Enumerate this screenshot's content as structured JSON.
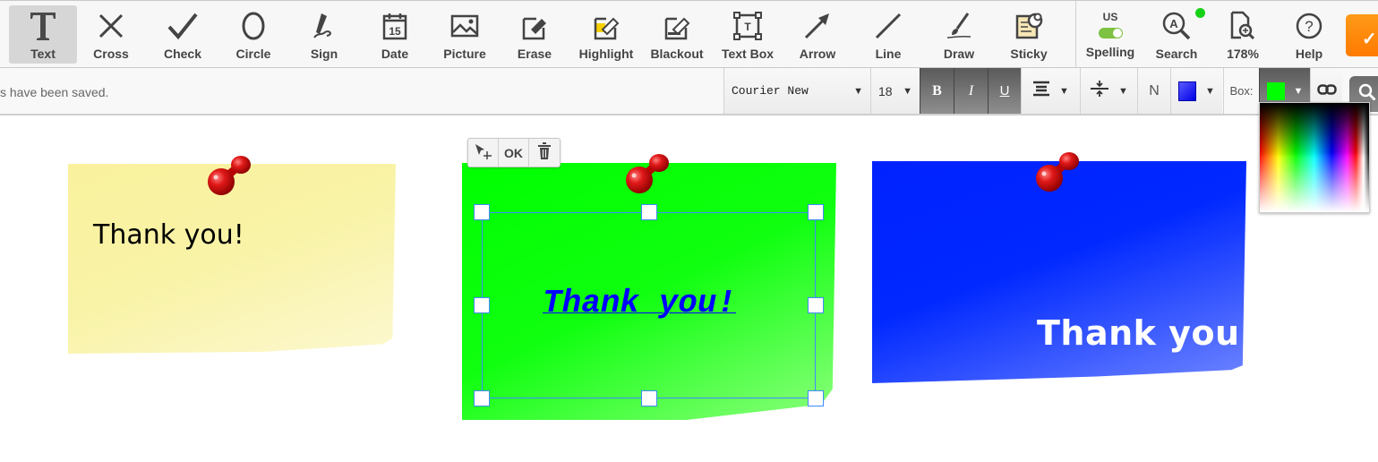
{
  "toolbar": {
    "tools": [
      {
        "id": "text",
        "label": "Text",
        "icon": "text-icon",
        "active": true
      },
      {
        "id": "cross",
        "label": "Cross",
        "icon": "cross-icon"
      },
      {
        "id": "check",
        "label": "Check",
        "icon": "check-icon"
      },
      {
        "id": "circle",
        "label": "Circle",
        "icon": "circle-icon"
      },
      {
        "id": "sign",
        "label": "Sign",
        "icon": "pen-signature-icon"
      },
      {
        "id": "date",
        "label": "Date",
        "icon": "calendar-icon",
        "icon_text": "15"
      },
      {
        "id": "picture",
        "label": "Picture",
        "icon": "image-icon"
      },
      {
        "id": "erase",
        "label": "Erase",
        "icon": "eraser-icon"
      },
      {
        "id": "highlight",
        "label": "Highlight",
        "icon": "highlighter-icon"
      },
      {
        "id": "blackout",
        "label": "Blackout",
        "icon": "blackout-icon"
      },
      {
        "id": "textbox",
        "label": "Text Box",
        "icon": "text-box-icon",
        "icon_text": "T"
      },
      {
        "id": "arrow",
        "label": "Arrow",
        "icon": "arrow-icon"
      },
      {
        "id": "line",
        "label": "Line",
        "icon": "line-icon"
      },
      {
        "id": "draw",
        "label": "Draw",
        "icon": "brush-icon"
      },
      {
        "id": "sticky",
        "label": "Sticky",
        "icon": "sticky-note-icon"
      }
    ],
    "spelling": {
      "lang": "US",
      "label": "Spelling",
      "enabled": true,
      "toggle_color": "#7dc242"
    },
    "search": {
      "label": "Search",
      "status_color": "#17d117"
    },
    "zoom": {
      "label": "178%"
    },
    "help": {
      "label": "Help"
    },
    "done_button": {
      "color": "#ff8a00",
      "icon": "check-icon"
    }
  },
  "format_bar": {
    "status": "s have been saved.",
    "font": "Courier New",
    "size": "18",
    "bold": "B",
    "italic": "I",
    "underline": "U",
    "normal": "N",
    "text_color": "#0000ff",
    "box_label": "Box:",
    "box_color": "#00ff00"
  },
  "notes": [
    {
      "id": "yellow",
      "text": "Thank you!",
      "bg": "#f9f19c",
      "text_color": "#000000"
    },
    {
      "id": "green",
      "text": "Thank you!",
      "bg": "#00ff00",
      "text_color": "#0000ff",
      "selected": true
    },
    {
      "id": "blue",
      "text": "Thank you!",
      "bg": "#0022ff",
      "text_color": "#ffffff"
    }
  ],
  "context_menu": {
    "ok": "OK"
  }
}
